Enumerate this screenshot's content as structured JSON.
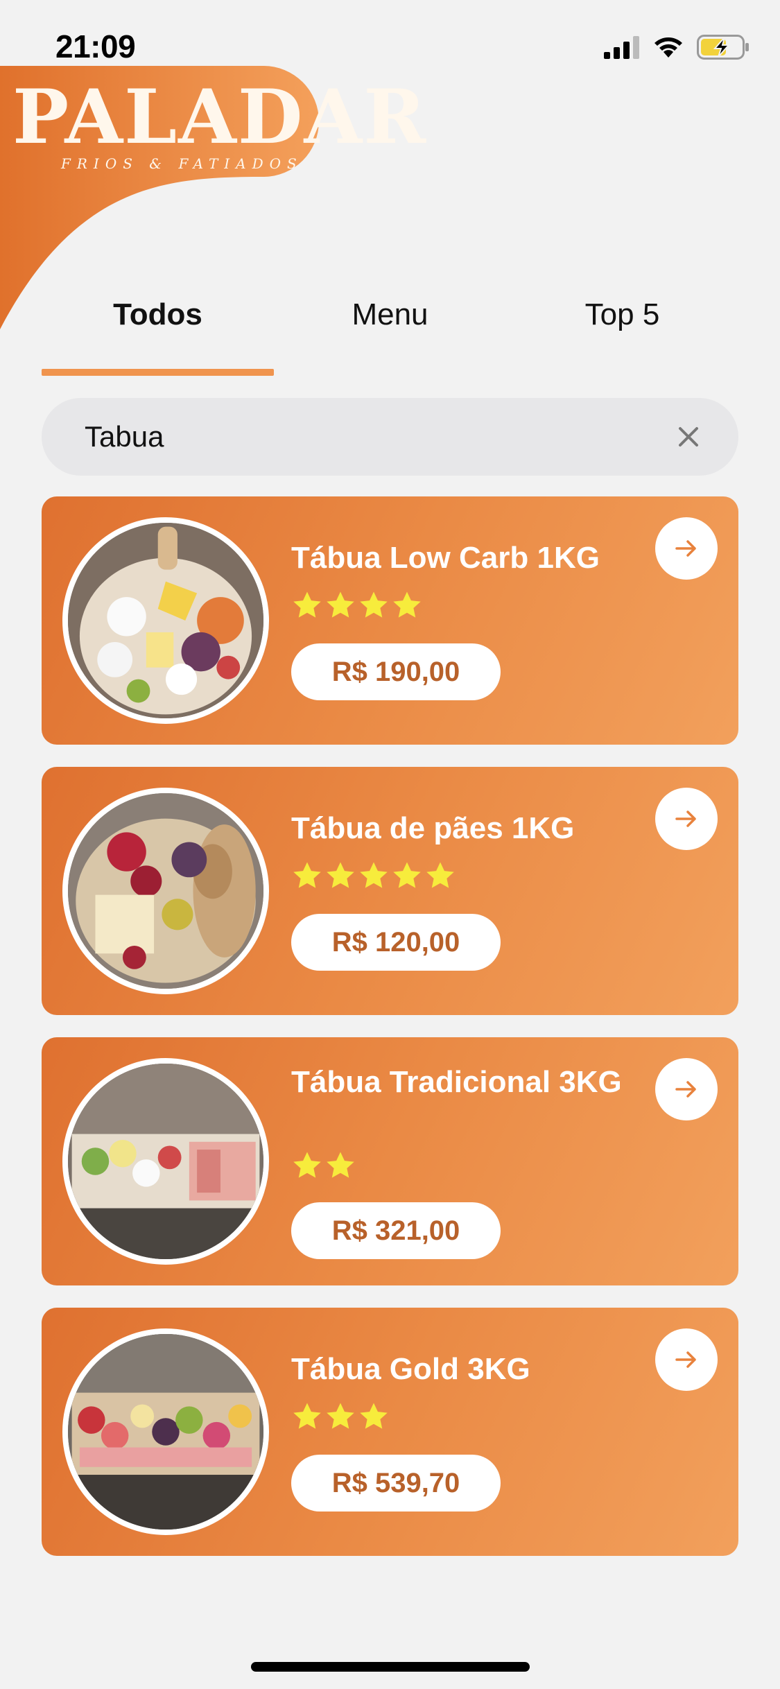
{
  "status_bar": {
    "time": "21:09"
  },
  "brand": {
    "name": "PALADAR",
    "tagline": "FRIOS & FATIADOS",
    "color": "#e8823c"
  },
  "tabs": [
    {
      "label": "Todos",
      "active": true
    },
    {
      "label": "Menu",
      "active": false
    },
    {
      "label": "Top 5",
      "active": false
    }
  ],
  "search": {
    "value": "Tabua",
    "clear_icon": "close-icon"
  },
  "products": [
    {
      "title": "Tábua Low Carb 1KG",
      "rating": 4,
      "price": "R$ 190,00"
    },
    {
      "title": "Tábua de pães 1KG",
      "rating": 5,
      "price": "R$ 120,00"
    },
    {
      "title": "Tábua Tradicional 3KG",
      "rating": 2,
      "price": "R$ 321,00"
    },
    {
      "title": "Tábua Gold 3KG",
      "rating": 3,
      "price": "R$ 539,70"
    }
  ],
  "colors": {
    "accent": "#f0944e",
    "card_start": "#df7130",
    "card_end": "#f2a05c",
    "star": "#f7ec3c",
    "price_text": "#b8612a"
  }
}
